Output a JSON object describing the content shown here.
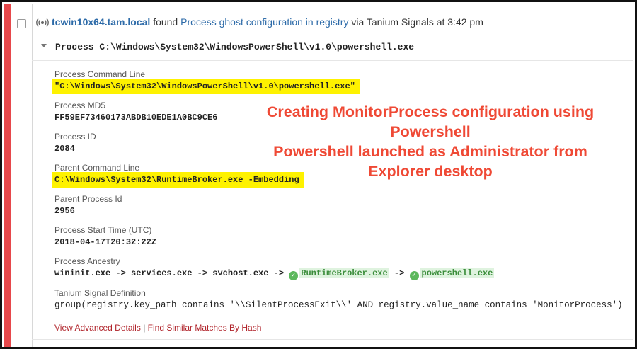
{
  "header": {
    "host": "tcwin10x64.tam.local",
    "found_text": "found",
    "finding": "Process ghost configuration in registry",
    "via_text": "via Tanium Signals at 3:42 pm"
  },
  "process_title": "Process C:\\Windows\\System32\\WindowsPowerShell\\v1.0\\powershell.exe",
  "fields": {
    "command_line": {
      "label": "Process Command Line",
      "value": "\"C:\\Windows\\System32\\WindowsPowerShell\\v1.0\\powershell.exe\""
    },
    "md5": {
      "label": "Process MD5",
      "value": "FF59EF73460173ABDB10EDE1A0BC9CE6"
    },
    "pid": {
      "label": "Process ID",
      "value": "2084"
    },
    "parent_command_line": {
      "label": "Parent Command Line",
      "value": "C:\\Windows\\System32\\RuntimeBroker.exe -Embedding"
    },
    "parent_pid": {
      "label": "Parent Process Id",
      "value": "2956"
    },
    "start_time": {
      "label": "Process Start Time (UTC)",
      "value": "2018-04-17T20:32:22Z"
    },
    "ancestry": {
      "label": "Process Ancestry",
      "prefix": "wininit.exe -> services.exe -> svchost.exe ->",
      "exe1": "RuntimeBroker.exe",
      "arrow": "->",
      "exe2": "powershell.exe"
    },
    "signal_definition": {
      "label": "Tanium Signal Definition",
      "value": "group(registry.key_path contains '\\\\SilentProcessExit\\\\' AND registry.value_name contains 'MonitorProcess')"
    }
  },
  "footer": {
    "advanced": "View Advanced Details",
    "separator": "|",
    "similar": "Find Similar Matches By Hash"
  },
  "annotation": {
    "line1": "Creating MonitorProcess configuration using",
    "line2": "Powershell",
    "line3": "Powershell launched as Administrator from",
    "line4": "Explorer desktop"
  },
  "icons": {
    "signal": "signal-broadcast-icon",
    "check": "check-circle-icon",
    "caret": "caret-down-icon"
  },
  "colors": {
    "accent_bar": "#e7484b",
    "link": "#2c6aa8",
    "highlight": "#fef200",
    "annotation": "#ef4935",
    "ok_green": "#5cb85c",
    "footer_link": "#b0232a"
  }
}
